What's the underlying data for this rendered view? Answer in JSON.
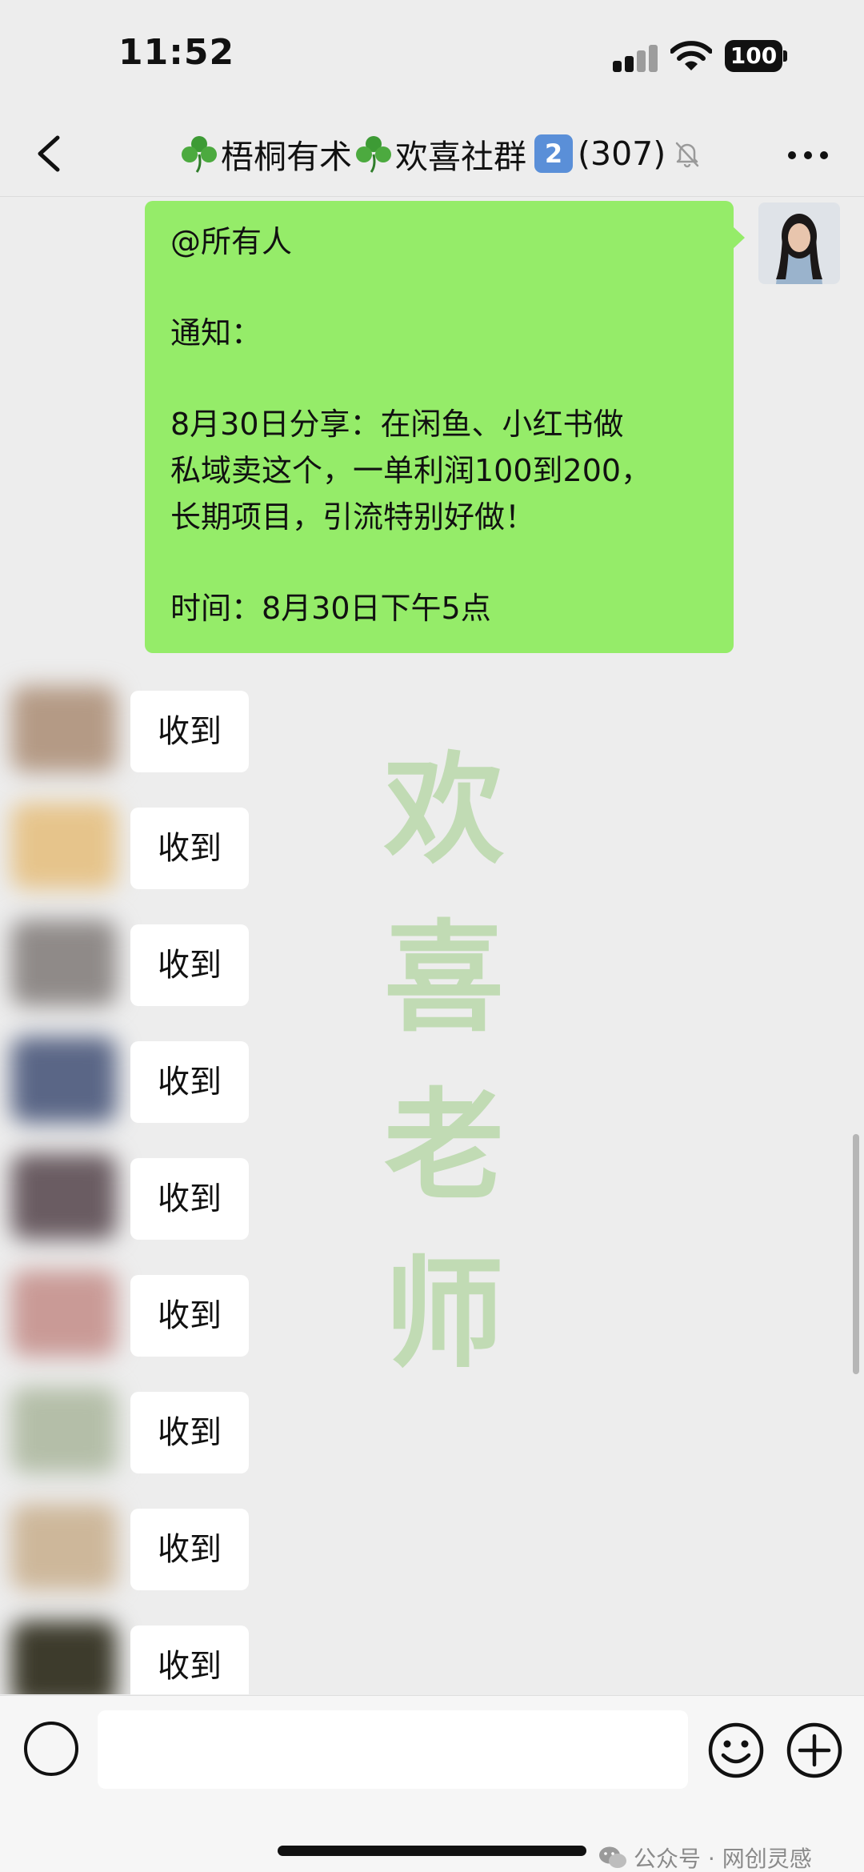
{
  "status_bar": {
    "time": "11:52",
    "battery": "100"
  },
  "nav": {
    "title_part1": "梧桐有术",
    "title_part2": "欢喜社群",
    "badge_number": "2",
    "member_count": "(307)"
  },
  "announcement": {
    "lines": [
      "@所有人",
      "",
      "通知：",
      "",
      "8月30日分享：在闲鱼、小红书做",
      "私域卖这个，一单利润100到200，",
      "长期项目，引流特别好做！",
      "",
      "时间：8月30日下午5点"
    ]
  },
  "replies": [
    "收到",
    "收到",
    "收到",
    "收到",
    "收到",
    "收到",
    "收到",
    "收到",
    "收到"
  ],
  "watermark": [
    "欢",
    "喜",
    "老",
    "师"
  ],
  "credit": "公众号 · 网创灵感",
  "colors": {
    "bubble_green": "#95ec69",
    "background": "#ededed",
    "badge_blue": "#5a8fd8",
    "avatar_blurs": [
      "#b49a85",
      "#e6c48b",
      "#8f8a88",
      "#5a6686",
      "#6a5c62",
      "#c99a96",
      "#b4bea8",
      "#cdb79a",
      "#3d3b2c"
    ]
  }
}
